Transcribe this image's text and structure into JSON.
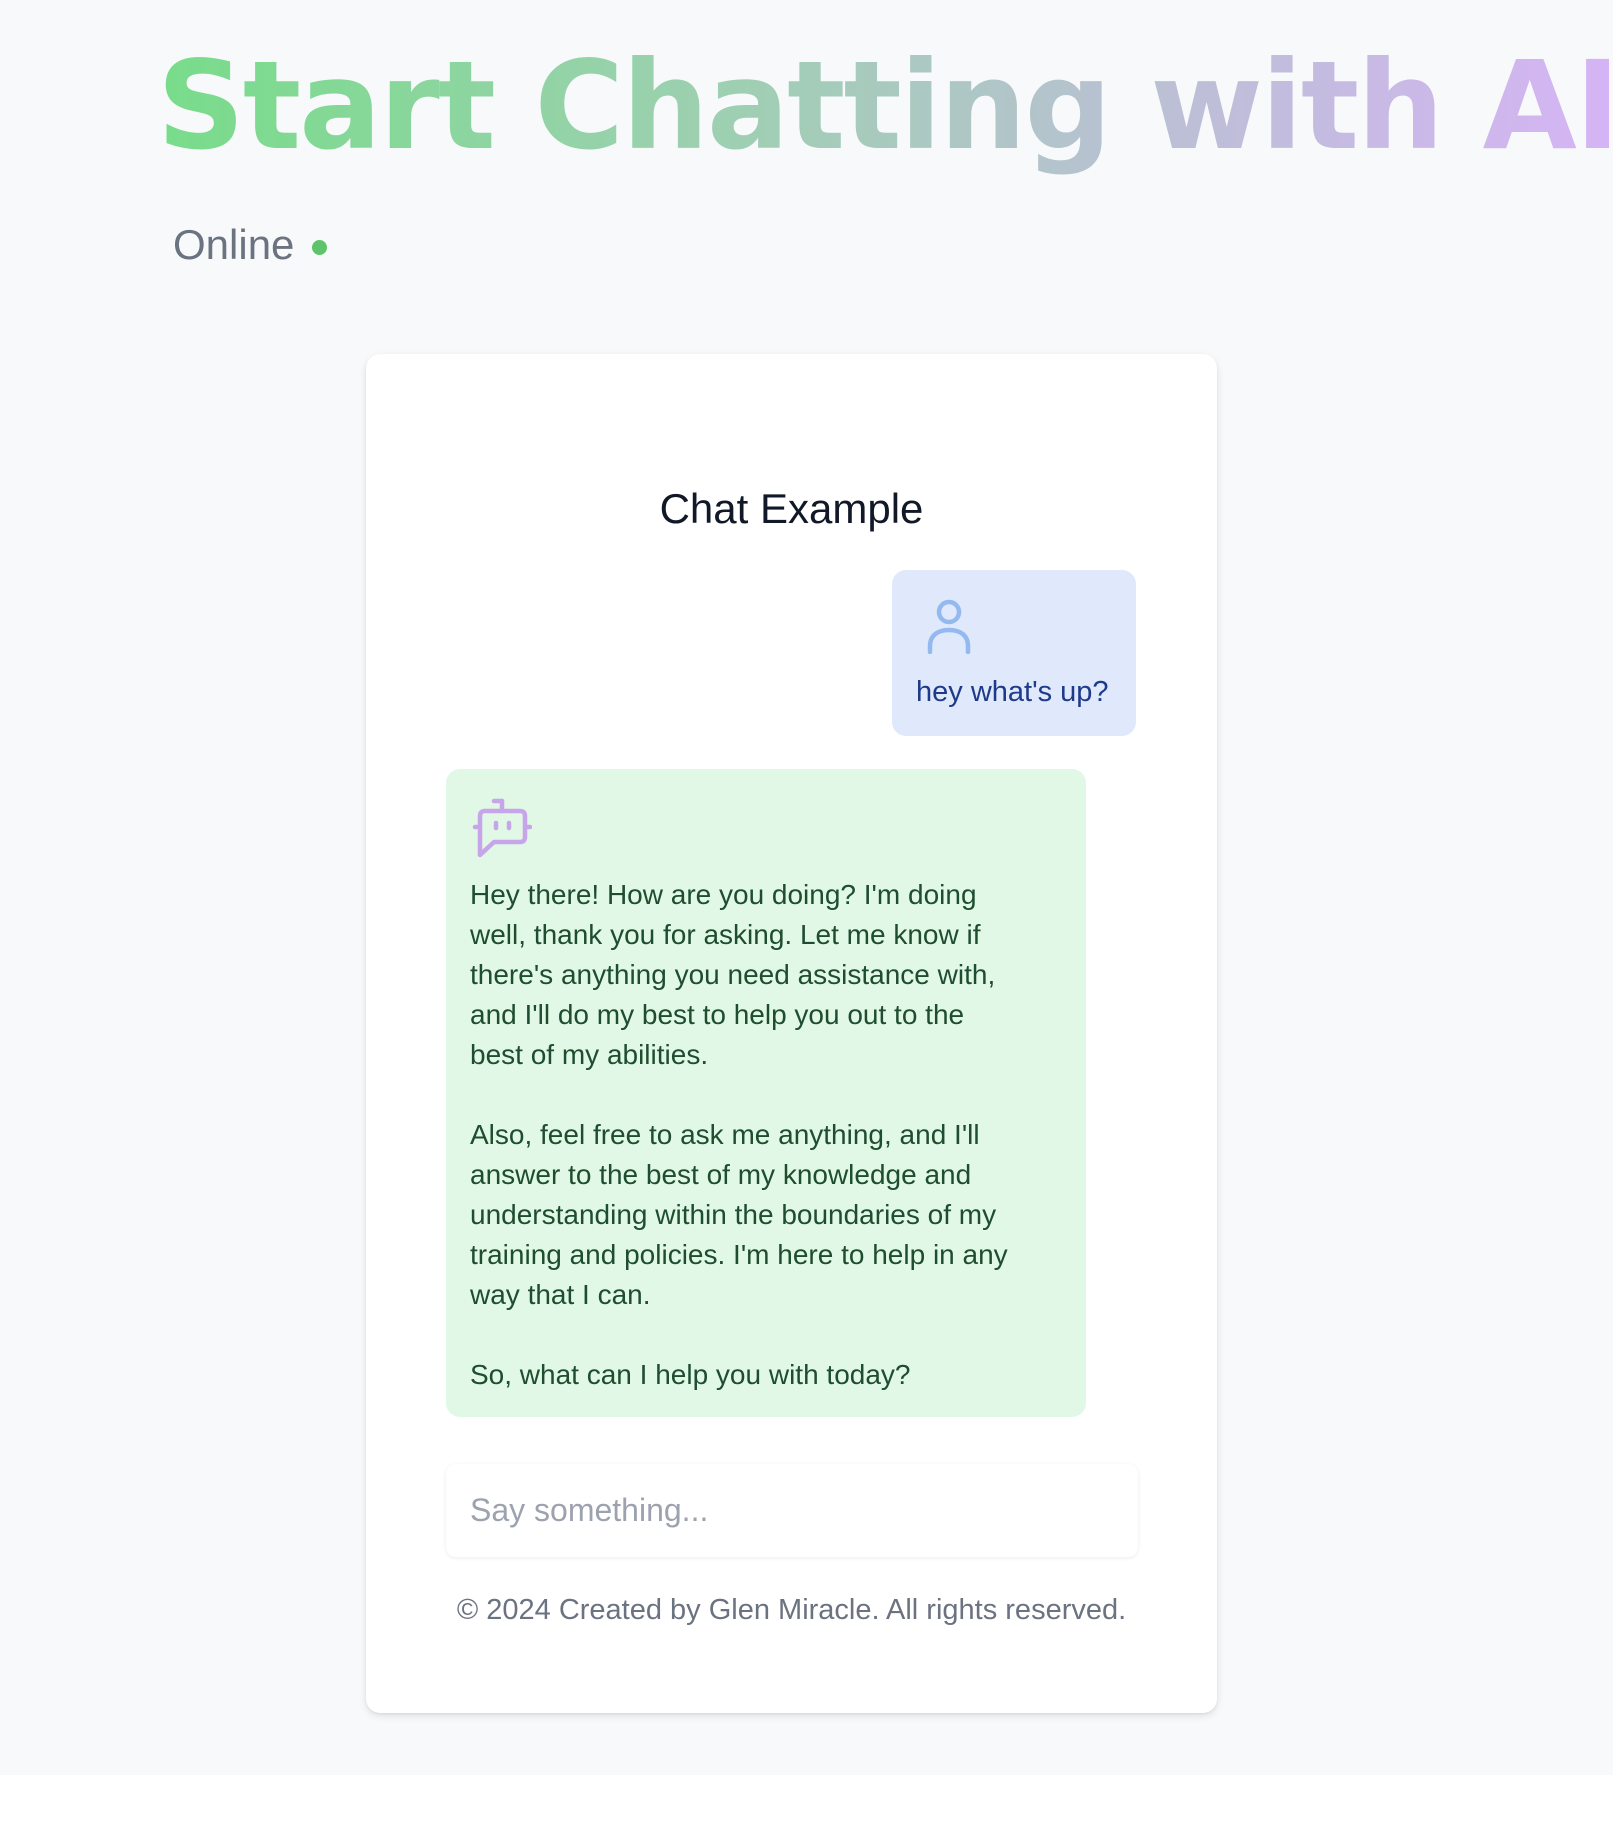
{
  "header": {
    "title": "Start Chatting with AI",
    "status_label": "Online",
    "status_color": "#5ec46b",
    "title_gradient": [
      "#78dc8a",
      "#d6b4f6"
    ]
  },
  "chat": {
    "title": "Chat Example",
    "messages": [
      {
        "role": "user",
        "icon": "user-icon",
        "text": "hey what's up?"
      },
      {
        "role": "assistant",
        "icon": "bot-icon",
        "paragraphs": [
          "Hey there! How are you doing? I'm doing\nwell, thank you for asking. Let me know if\nthere's anything you need assistance with,\nand I'll do my best to help you out to the\nbest of my abilities.",
          "Also, feel free to ask me anything, and I'll\nanswer to the best of my knowledge and\nunderstanding within the boundaries of my\ntraining and policies. I'm here to help in any\nway that I can.",
          "So, what can I help you with today?"
        ]
      }
    ],
    "input": {
      "placeholder": "Say something...",
      "value": ""
    },
    "footer": "© 2024 Created by Glen Miracle. All rights reserved."
  },
  "colors": {
    "user_bubble": "#dfe9fb",
    "bot_bubble": "#e1f8e6",
    "page_background": "#f8f9fb"
  }
}
